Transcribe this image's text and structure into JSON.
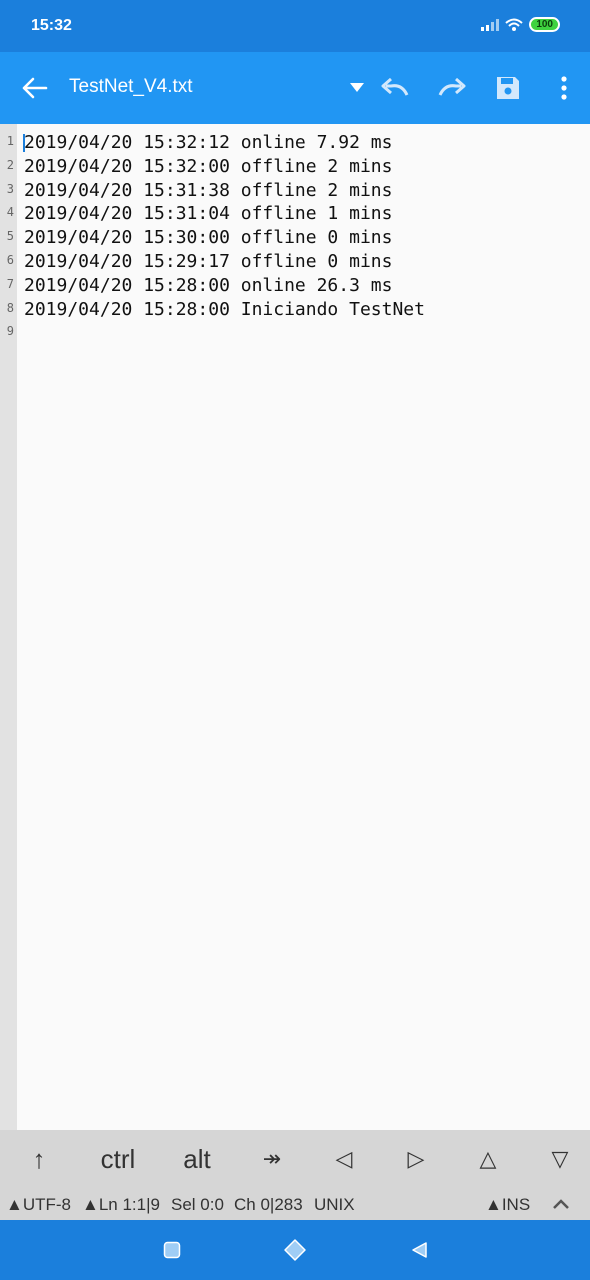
{
  "status_bar": {
    "time": "15:32",
    "battery": "100"
  },
  "toolbar": {
    "back_icon": "arrow-left-icon",
    "file_name": "TestNet_V4.txt",
    "dropdown_icon": "caret-down-icon",
    "undo_icon": "undo-icon",
    "redo_icon": "redo-icon",
    "save_icon": "save-icon",
    "more_icon": "more-vert-icon"
  },
  "editor": {
    "lines": [
      {
        "num": "1",
        "text": "2019/04/20 15:32:12 online 7.92 ms"
      },
      {
        "num": "2",
        "text": "2019/04/20 15:32:00 offline 2 mins"
      },
      {
        "num": "3",
        "text": "2019/04/20 15:31:38 offline 2 mins"
      },
      {
        "num": "4",
        "text": "2019/04/20 15:31:04 offline 1 mins"
      },
      {
        "num": "5",
        "text": "2019/04/20 15:30:00 offline 0 mins"
      },
      {
        "num": "6",
        "text": "2019/04/20 15:29:17 offline 0 mins"
      },
      {
        "num": "7",
        "text": "2019/04/20 15:28:00 online 26.3 ms"
      },
      {
        "num": "8",
        "text": "2019/04/20 15:28:00 Iniciando TestNet"
      },
      {
        "num": "9",
        "text": ""
      }
    ]
  },
  "keys": [
    "↑",
    "ctrl",
    "alt",
    "↠",
    "◁",
    "▷",
    "△",
    "▽"
  ],
  "info_bar": {
    "encoding": "▲UTF-8",
    "position": "▲Ln 1:1|9",
    "selection": "Sel 0:0",
    "chars": "Ch 0|283",
    "line_ending": "UNIX",
    "mode": "▲INS",
    "expand_icon": "chevron-up-icon"
  },
  "nav_bar": {
    "recents_icon": "square-icon",
    "home_icon": "diamond-icon",
    "back_icon": "triangle-back-icon"
  }
}
